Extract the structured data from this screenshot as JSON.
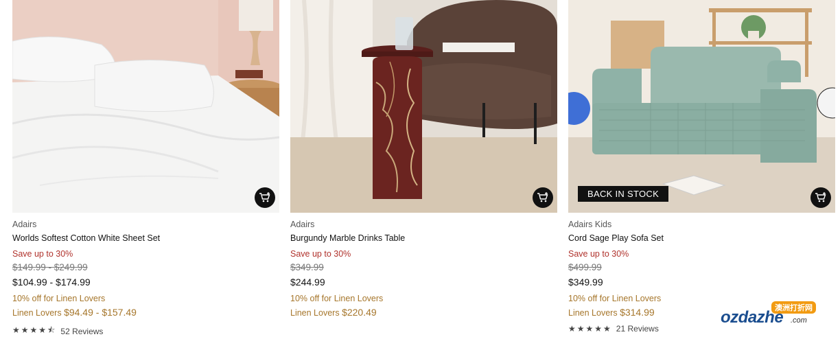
{
  "products": [
    {
      "brand": "Adairs",
      "title": "Worlds Softest Cotton White Sheet Set",
      "save": "Save up to 30%",
      "was_price": "$149.99 - $249.99",
      "price": "$104.99 - $174.99",
      "promo": "10% off for Linen Lovers",
      "member_label": "Linen Lovers",
      "member_price": "$94.49 - $157.49",
      "stars": "★★★★⯪",
      "rating": 4.5,
      "reviews": "52 Reviews",
      "badge": "",
      "cart_icon": "add-to-cart-icon"
    },
    {
      "brand": "Adairs",
      "title": "Burgundy Marble Drinks Table",
      "save": "Save up to 30%",
      "was_price": "$349.99",
      "price": "$244.99",
      "promo": "10% off for Linen Lovers",
      "member_label": "Linen Lovers",
      "member_price": "$220.49",
      "stars": "",
      "reviews": "",
      "badge": "",
      "cart_icon": "add-to-cart-icon"
    },
    {
      "brand": "Adairs Kids",
      "title": "Cord Sage Play Sofa Set",
      "save": "Save up to 30%",
      "was_price": "$499.99",
      "price": "$349.99",
      "promo": "10% off for Linen Lovers",
      "member_label": "Linen Lovers",
      "member_price": "$314.99",
      "stars": "★★★★★",
      "rating": 5,
      "reviews": "21 Reviews",
      "badge": "BACK IN STOCK",
      "cart_icon": "add-to-cart-icon"
    }
  ],
  "watermark": {
    "text": "ozdazhe",
    "domain": ".com",
    "chinese": "澳洲打折网"
  },
  "colors": {
    "sale": "#b0322c",
    "member": "#a6762b",
    "cart_button": "#111111"
  }
}
